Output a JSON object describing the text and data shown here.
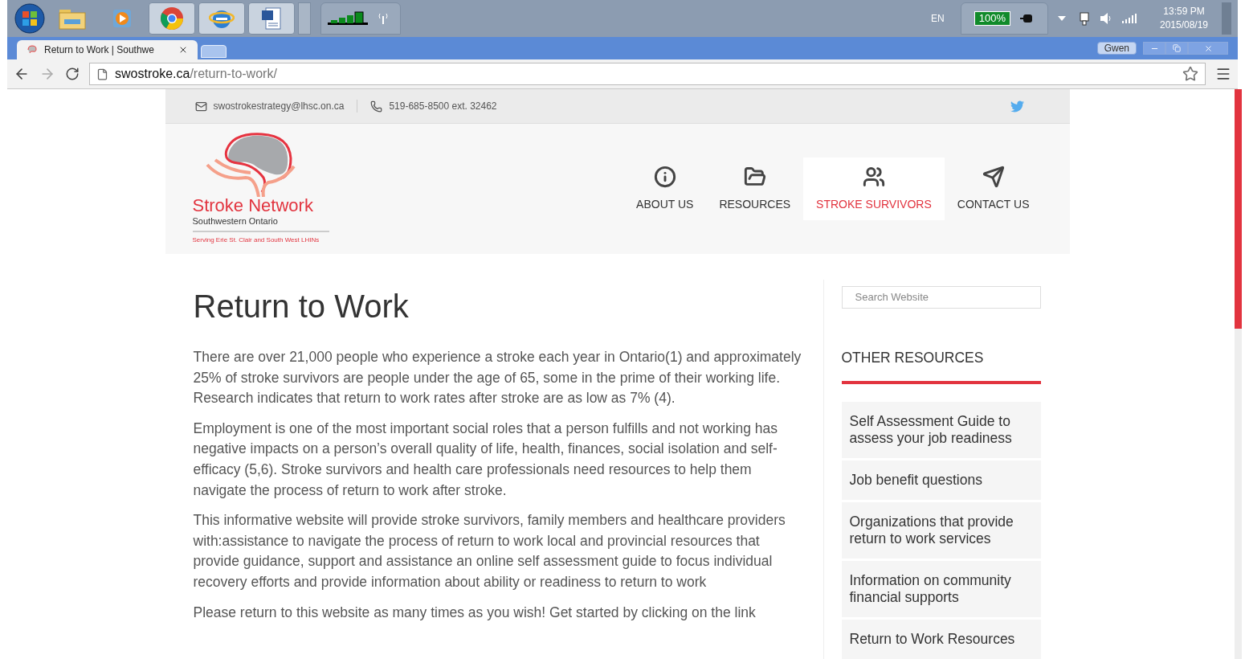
{
  "taskbar": {
    "language": "EN",
    "battery": "100%",
    "time": "13:59 PM",
    "date": "2015/08/19"
  },
  "browser": {
    "tab": {
      "title": "Return to Work | Southwe"
    },
    "user": "Gwen",
    "url": {
      "domain": "swostroke.ca",
      "path": "/return-to-work/"
    }
  },
  "topbar": {
    "email": "swostrokestrategy@lhsc.on.ca",
    "phone": "519-685-8500 ext. 32462"
  },
  "logo": {
    "word_1": "Stroke",
    "word_2": "Network",
    "subtitle": "Southwestern Ontario",
    "tagline": "Serving Erie St. Clair and South West LHINs"
  },
  "nav": [
    {
      "label": "ABOUT US",
      "kind": "info",
      "selected": false
    },
    {
      "label": "RESOURCES",
      "kind": "folder",
      "selected": false
    },
    {
      "label": "STROKE SURVIVORS",
      "kind": "people",
      "selected": true
    },
    {
      "label": "CONTACT US",
      "kind": "send",
      "selected": false
    }
  ],
  "page": {
    "title": "Return to Work",
    "paragraphs": [
      "There are over 21,000 people who experience a stroke each year in Ontario(1) and approximately 25% of stroke survivors are people under the age of 65, some in the prime of their working life. Research indicates that return to work rates after stroke are as low as 7% (4).",
      "Employment is one of the most important social roles that a person fulfills and not working has negative impacts on a person’s overall quality of life, health, finances, social isolation and self-efficacy (5,6). Stroke survivors and health care professionals need resources to help them navigate the process of return to work after stroke.",
      "This informative website will provide stroke survivors, family members and healthcare providers with:assistance to navigate the process of return to work local and provincial resources that provide guidance, support and assistance an online self assessment guide to focus individual recovery efforts and provide information about ability or readiness to return to work",
      "Please return to this website as many times as you wish!  Get started by clicking on the link"
    ]
  },
  "sidebar": {
    "search": {
      "placeholder": "Search Website"
    },
    "heading": "OTHER RESOURCES",
    "links": [
      "Self Assessment Guide to assess your job readiness",
      "Job benefit questions",
      "Organizations that provide return to work services",
      "Information on community financial supports",
      "Return to Work Resources"
    ]
  }
}
